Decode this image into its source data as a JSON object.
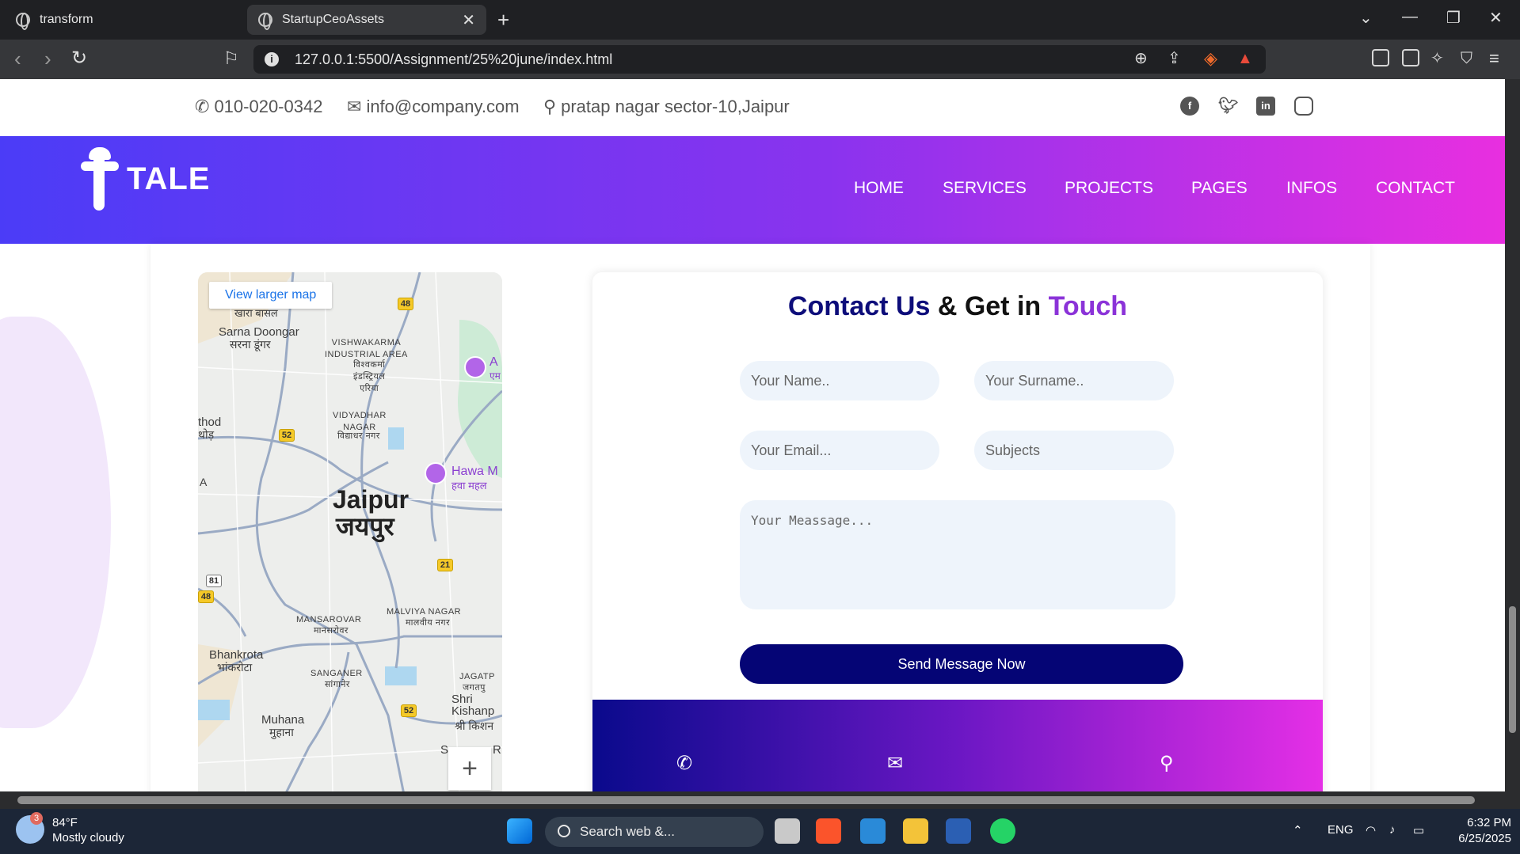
{
  "browser": {
    "tabs": [
      {
        "title": "transform"
      },
      {
        "title": "StartupCeoAssets"
      }
    ],
    "url": "127.0.0.1:5500/Assignment/25%20june/index.html"
  },
  "topbar": {
    "phone": "010-020-0342",
    "email": "info@company.com",
    "address": "pratap nagar sector-10,Jaipur"
  },
  "header": {
    "logo_text": "TALE",
    "nav": [
      "HOME",
      "SERVICES",
      "PROJECTS",
      "PAGES",
      "INFOS",
      "CONTACT"
    ]
  },
  "map": {
    "view_larger": "View larger map",
    "city_en": "Jaipur",
    "city_hi": "जयपुर",
    "labels": {
      "khara": "खारा बासल",
      "sarna_en": "Sarna Doongar",
      "sarna_hi": "सरना डूंगर",
      "vishwakarma_en": "VISHWAKARMA\nINDUSTRIAL AREA",
      "vishwakarma_hi": "विश्वकर्मा\nइंडस्ट्रियल\nएरिया",
      "thod_en": "thod",
      "thod_hi": "थोड़",
      "vidyadhar_en": "VIDYADHAR\nNAGAR",
      "vidyadhar_hi": "विद्याधर नगर",
      "a": "A",
      "hawa_en": "Hawa M",
      "hawa_hi": "हवा महल",
      "amer_en": "A",
      "amer_hi": "एम",
      "mansarovar_en": "MANSAROVAR",
      "mansarovar_hi": "मानसरोवर",
      "malviya_en": "MALVIYA NAGAR",
      "malviya_hi": "मालवीय नगर",
      "bhankrota_en": "Bhankrota",
      "bhankrota_hi": "भांकरोटा",
      "sanganer_en": "SANGANER",
      "sanganer_hi": "सांगानेर",
      "jagatpura_en": "JAGATP",
      "jagatpura_hi": "जगतपु",
      "shri_en": "Shri\nKishanp",
      "shri_hi": "श्री किशन",
      "muhana_en": "Muhana",
      "muhana_hi": "मुहाना",
      "s": "S",
      "r": "R"
    },
    "shields": [
      "48",
      "52",
      "21",
      "81",
      "48",
      "52"
    ],
    "zoom_in": "+"
  },
  "contact": {
    "title_part1": "Contact Us",
    "title_part2": " & Get in ",
    "title_part3": "Touch",
    "name_placeholder": "Your Name..",
    "surname_placeholder": "Your Surname..",
    "email_placeholder": "Your Email...",
    "subject_placeholder": "Subjects",
    "message_placeholder": "Your Meassage...",
    "send_label": "Send Message Now"
  },
  "taskbar": {
    "temperature": "84°F",
    "weather": "Mostly cloudy",
    "weather_badge": "3",
    "search": "Search web &...",
    "lang": "ENG",
    "time": "6:32 PM",
    "date": "6/25/2025"
  },
  "colors": {
    "header_gradient_start": "#4b3cf7",
    "header_gradient_end": "#e82fe0",
    "title_blue": "#0d0d7a",
    "title_purple": "#8b33d8",
    "button_navy": "#050575"
  }
}
